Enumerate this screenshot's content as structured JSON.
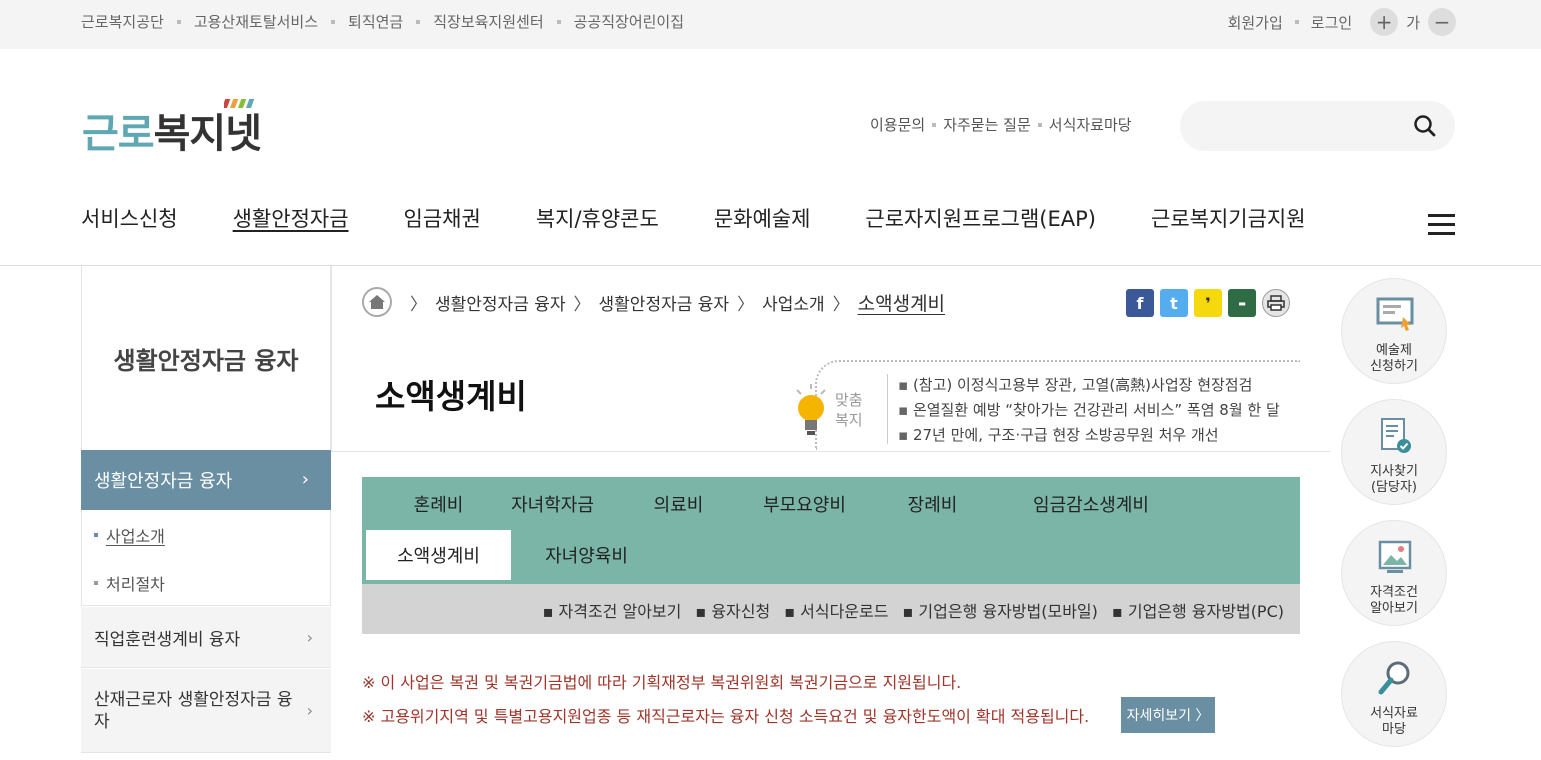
{
  "utility": {
    "left_links": [
      "근로복지공단",
      "고용산재토탈서비스",
      "퇴직연금",
      "직장보육지원센터",
      "공공직장어린이집"
    ],
    "signup": "회원가입",
    "login": "로그인",
    "zoom_in": "+",
    "zoom_label": "가",
    "zoom_out": "−"
  },
  "header": {
    "logo_part1": "근로",
    "logo_part2": "복지넷",
    "links": [
      "이용문의",
      "자주묻는 질문",
      "서식자료마당"
    ],
    "search_placeholder": ""
  },
  "gnb": {
    "items": [
      "서비스신청",
      "생활안정자금",
      "임금채권",
      "복지/휴양콘도",
      "문화예술제",
      "근로자지원프로그램(EAP)",
      "근로복지기금지원"
    ],
    "active_index": 1
  },
  "sidebar": {
    "title": "생활안정자금 융자",
    "active": "생활안정자금 융자",
    "sub_items": [
      "사업소개",
      "처리절차"
    ],
    "items": [
      "직업훈련생계비 융자",
      "산재근로자 생활안정자금 융자"
    ]
  },
  "breadcrumb": {
    "items": [
      "생활안정자금 융자",
      "생활안정자금 융자",
      "사업소개"
    ],
    "current": "소액생계비"
  },
  "page": {
    "title": "소액생계비",
    "custom_label_1": "맞춤",
    "custom_label_2": "복지",
    "news": [
      "(참고) 이정식고용부 장관, 고열(高熱)사업장 현장점검",
      "온열질환 예방 “찾아가는 건강관리 서비스” 폭염 8월 한 달",
      "27년 만에, 구조·구급 현장 소방공무원 처우 개선"
    ]
  },
  "tabs": {
    "row1": [
      "혼례비",
      "자녀학자금",
      "의료비",
      "부모요양비",
      "장례비",
      "임금감소생계비"
    ],
    "row2": [
      "소액생계비",
      "자녀양육비"
    ],
    "active": "소액생계비"
  },
  "subtabs": [
    "자격조건 알아보기",
    "융자신청",
    "서식다운로드",
    "기업은행 융자방법(모바일)",
    "기업은행 융자방법(PC)"
  ],
  "notices": [
    "※ 이 사업은 복권 및 복권기금법에 따라 기획재정부 복권위원회 복권기금으로 지원됩니다.",
    "※ 고용위기지역 및 특별고용지원업종 등 재직근로자는 융자 신청 소득요건 및 융자한도액이 확대 적용됩니다."
  ],
  "more_button": "자세히보기 〉",
  "quick_menu": [
    {
      "line1": "예술제",
      "line2": "신청하기",
      "icon": "artwork-apply-icon"
    },
    {
      "line1": "지사찾기",
      "line2": "(담당자)",
      "icon": "branch-find-icon"
    },
    {
      "line1": "자격조건",
      "line2": "알아보기",
      "icon": "qualification-icon"
    },
    {
      "line1": "서식자료",
      "line2": "마당",
      "icon": "magnifier-icon"
    }
  ],
  "colors": {
    "accent_blue": "#6a8fa3",
    "tab_green": "#7ab5a8",
    "notice_red": "#a0352a",
    "logo_teal": "#5fa7b2"
  }
}
